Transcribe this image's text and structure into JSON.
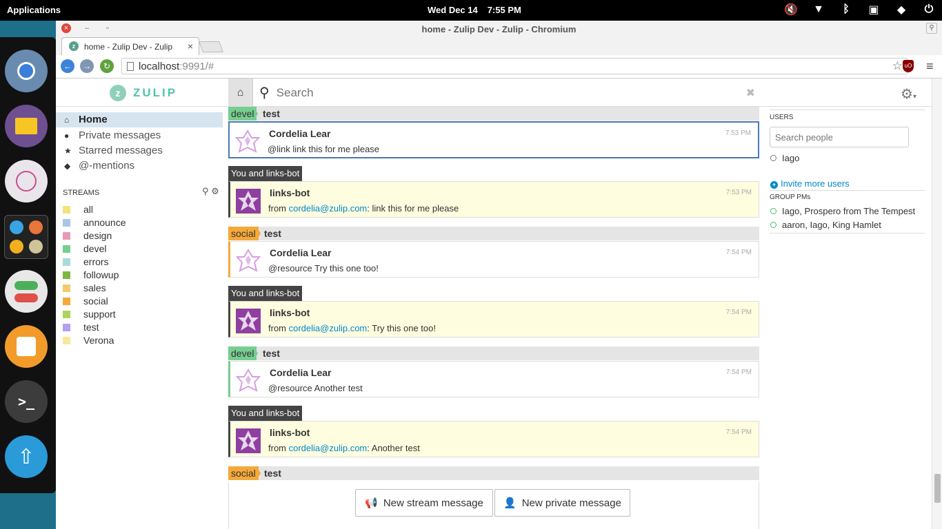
{
  "system": {
    "applications_label": "Applications",
    "date": "Wed Dec 14",
    "time": "7:55 PM"
  },
  "browser": {
    "window_title": "home - Zulip Dev - Zulip - Chromium",
    "tab_title": "home - Zulip Dev - Zulip",
    "url_host": "localhost",
    "url_path": ":9991/#"
  },
  "zulip": {
    "brand": "ZULIP",
    "search_placeholder": "Search",
    "nav": [
      {
        "label": "Home",
        "icon": "home-icon"
      },
      {
        "label": "Private messages",
        "icon": "user-icon"
      },
      {
        "label": "Starred messages",
        "icon": "star-icon"
      },
      {
        "label": "@-mentions",
        "icon": "tag-icon"
      }
    ],
    "streams_header": "STREAMS",
    "streams": [
      {
        "name": "all",
        "color": "#f5e37c"
      },
      {
        "name": "announce",
        "color": "#a8c6e5"
      },
      {
        "name": "design",
        "color": "#e79ab5"
      },
      {
        "name": "devel",
        "color": "#76ce90"
      },
      {
        "name": "errors",
        "color": "#a6dcd8"
      },
      {
        "name": "followup",
        "color": "#7fb640"
      },
      {
        "name": "sales",
        "color": "#f4ca6d"
      },
      {
        "name": "social",
        "color": "#f4a93a"
      },
      {
        "name": "support",
        "color": "#b0d25c"
      },
      {
        "name": "test",
        "color": "#b3a0f0"
      },
      {
        "name": "Verona",
        "color": "#f9e89a"
      }
    ],
    "messages": [
      {
        "kind": "stream",
        "stream": "devel",
        "stream_color": "#76ce90",
        "topic": "test",
        "sender": "Cordelia Lear",
        "time": "7:53 PM",
        "content": "@link link this for me please",
        "selected": true
      },
      {
        "kind": "pm",
        "header": "You and links-bot",
        "sender": "links-bot",
        "time": "7:53 PM",
        "link": "cordelia@zulip.com",
        "rest": ": link this for me please",
        "prefix": "from "
      },
      {
        "kind": "stream",
        "stream": "social",
        "stream_color": "#f4a93a",
        "topic": "test",
        "sender": "Cordelia Lear",
        "time": "7:54 PM",
        "content": "@resource Try this one too!"
      },
      {
        "kind": "pm",
        "header": "You and links-bot",
        "sender": "links-bot",
        "time": "7:54 PM",
        "link": "cordelia@zulip.com",
        "rest": ": Try this one too!",
        "prefix": "from "
      },
      {
        "kind": "stream",
        "stream": "devel",
        "stream_color": "#76ce90",
        "topic": "test",
        "sender": "Cordelia Lear",
        "time": "7:54 PM",
        "content": "@resource Another test"
      },
      {
        "kind": "pm",
        "header": "You and links-bot",
        "sender": "links-bot",
        "time": "7:54 PM",
        "link": "cordelia@zulip.com",
        "rest": ": Another test",
        "prefix": "from "
      },
      {
        "kind": "streamonly",
        "stream": "social",
        "stream_color": "#f4a93a",
        "topic": "test"
      }
    ],
    "compose": {
      "new_stream": "New stream message",
      "new_private": "New private message"
    },
    "right": {
      "users_header": "USERS",
      "search_people_placeholder": "Search people",
      "users": [
        "Iago"
      ],
      "invite": "Invite more users",
      "group_pms_header": "GROUP PMs",
      "group_pms": [
        "Iago, Prospero from The Tempest",
        "aaron, Iago, King Hamlet"
      ]
    }
  }
}
